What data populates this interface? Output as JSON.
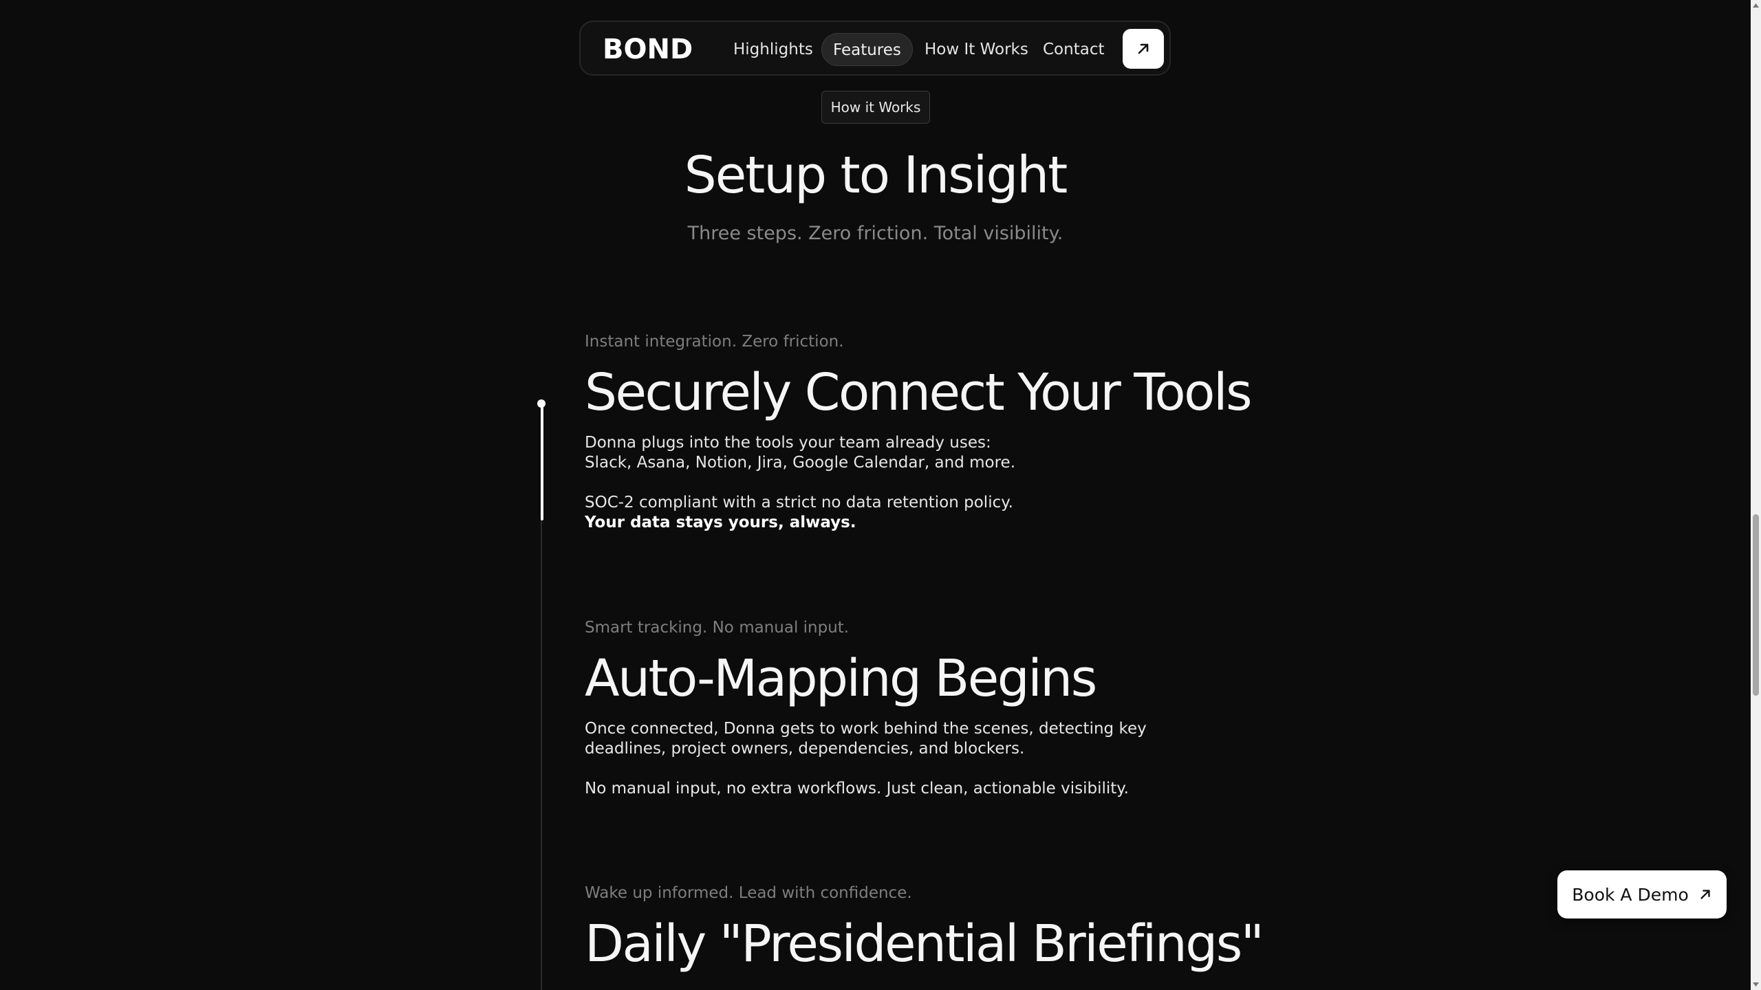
{
  "nav": {
    "brand": "BOND",
    "items": [
      {
        "label": "Highlights"
      },
      {
        "label": "Features"
      },
      {
        "label": "How It Works"
      },
      {
        "label": "Contact"
      }
    ],
    "active_item": "Features",
    "cta_icon": "arrow-up-right-icon"
  },
  "section": {
    "badge": "How it Works",
    "title": "Setup to Insight",
    "subtitle": "Three steps. Zero friction. Total visibility."
  },
  "steps": [
    {
      "kicker": "Instant integration. Zero friction.",
      "title": "Securely Connect Your Tools",
      "body": [
        "Donna plugs into the tools your team already uses:",
        "Slack, Asana, Notion, Jira, Google Calendar, and more.",
        "SOC-2 compliant with a strict no data retention policy.",
        "Your data stays yours, always."
      ]
    },
    {
      "kicker": "Smart tracking. No manual input.",
      "title": "Auto-Mapping Begins",
      "body": [
        "Once connected, Donna gets to work behind the scenes, detecting key",
        "deadlines, project owners, dependencies, and blockers.",
        "No manual input, no extra workflows. Just clean, actionable visibility."
      ]
    },
    {
      "kicker": "Wake up informed. Lead with confidence.",
      "title": "Daily \"Presidential Briefings\""
    }
  ],
  "floating_cta": {
    "label": "Book A Demo",
    "icon": "arrow-up-right-icon"
  },
  "timeline_progress": 0.2,
  "colors": {
    "background": "#0c0c0c",
    "accent": "#ffffff",
    "muted_text": "#7e7e7e"
  }
}
